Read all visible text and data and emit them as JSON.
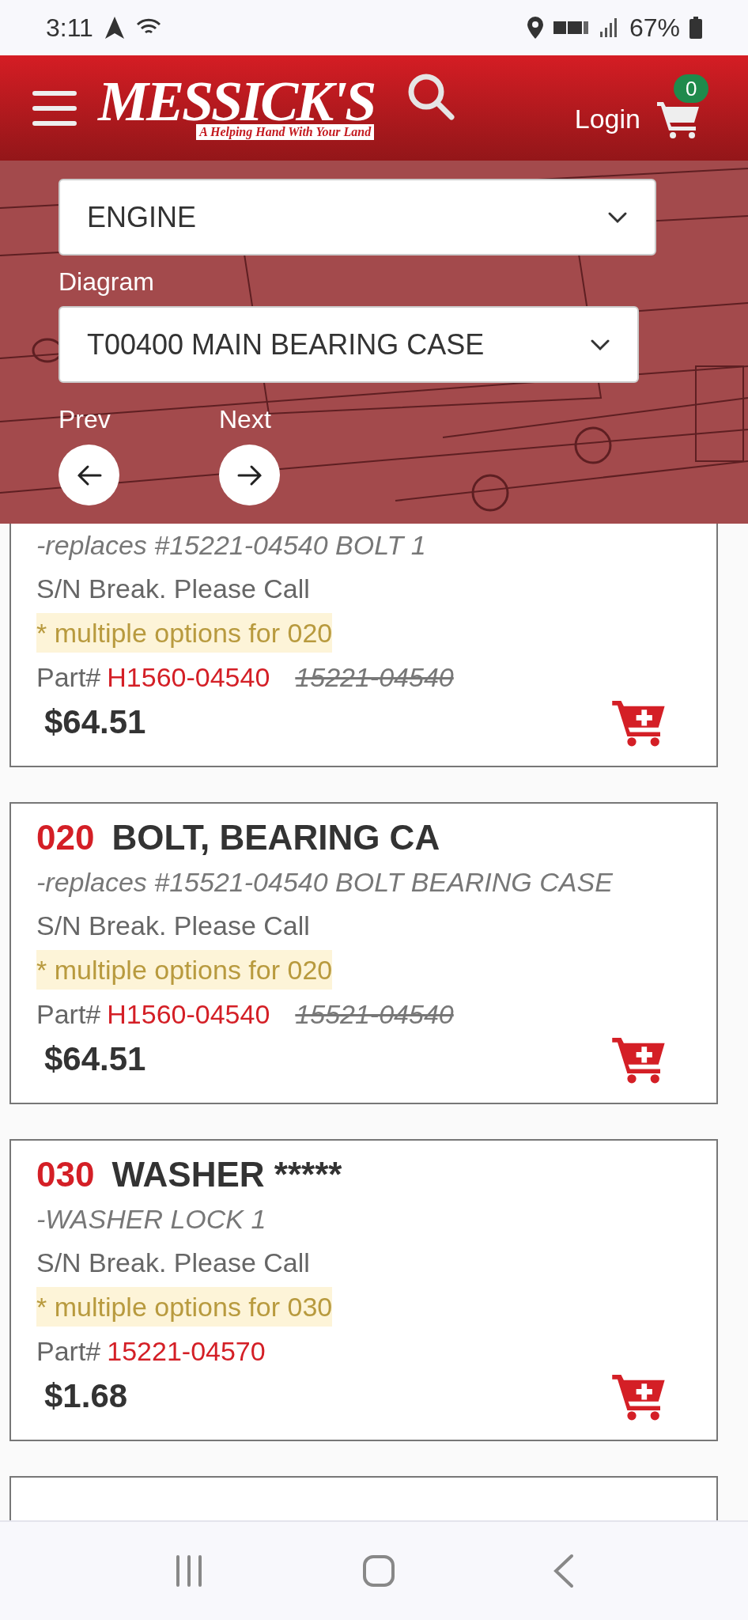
{
  "status_bar": {
    "time": "3:11",
    "battery": "67%"
  },
  "header": {
    "logo": "MESSICK'S",
    "tagline": "A Helping Hand With Your Land",
    "login": "Login",
    "cart_count": "0"
  },
  "filters": {
    "category": {
      "value": "ENGINE"
    },
    "diagram": {
      "label": "Diagram",
      "value": "T00400 MAIN BEARING CASE"
    },
    "prev": "Prev",
    "next": "Next"
  },
  "parts": [
    {
      "note": "-replaces #15221-04540 BOLT 1",
      "serial": "S/N Break. Please Call",
      "options": "* multiple options for 020",
      "part_label": "Part#",
      "part_number": "H1560-04540",
      "old_part_number": "15221-04540",
      "price": "$64.51"
    },
    {
      "ref": "020",
      "name": "BOLT, BEARING CA",
      "note": "-replaces #15521-04540 BOLT BEARING CASE",
      "serial": "S/N Break. Please Call",
      "options": "* multiple options for 020",
      "part_label": "Part#",
      "part_number": "H1560-04540",
      "old_part_number": "15521-04540",
      "price": "$64.51"
    },
    {
      "ref": "030",
      "name": "WASHER *****",
      "note": "-WASHER LOCK 1",
      "serial": "S/N Break. Please Call",
      "options": "* multiple options for 030",
      "part_label": "Part#",
      "part_number": "15221-04570",
      "price": "$1.68"
    }
  ]
}
